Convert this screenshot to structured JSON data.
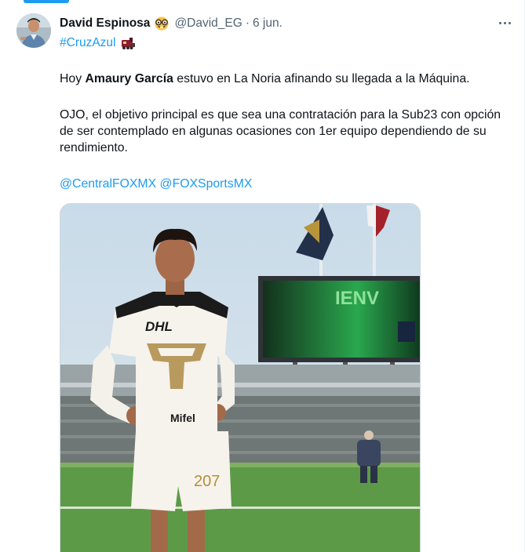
{
  "tweet": {
    "author": {
      "display_name": "David Espinosa",
      "name_emoji": "nerd-face-emoji",
      "handle": "@David_EG",
      "separator": "·",
      "timestamp": "6 jun."
    },
    "hashtag": "#CruzAzul",
    "hashtag_emoji": "train-emoji",
    "paragraph1": {
      "before": "Hoy ",
      "bold": "Amaury García",
      "after": " estuvo en La Noria afinando su llegada a la Máquina."
    },
    "paragraph2": "OJO, el objetivo principal es que sea una contratación para la Sub23 con opción de ser contemplado en algunas ocasiones con 1er equipo dependiendo de su rendimiento.",
    "mentions": [
      "@CentralFOXMX",
      "@FOXSportsMX"
    ],
    "photo": {
      "sponsor": "DHL",
      "shirt_text": "Mifel",
      "shorts_number": "207",
      "scoreboard_text": "IENV"
    }
  },
  "colors": {
    "link": "#1d9bf0",
    "text": "#0f1419",
    "secondary": "#536471"
  }
}
